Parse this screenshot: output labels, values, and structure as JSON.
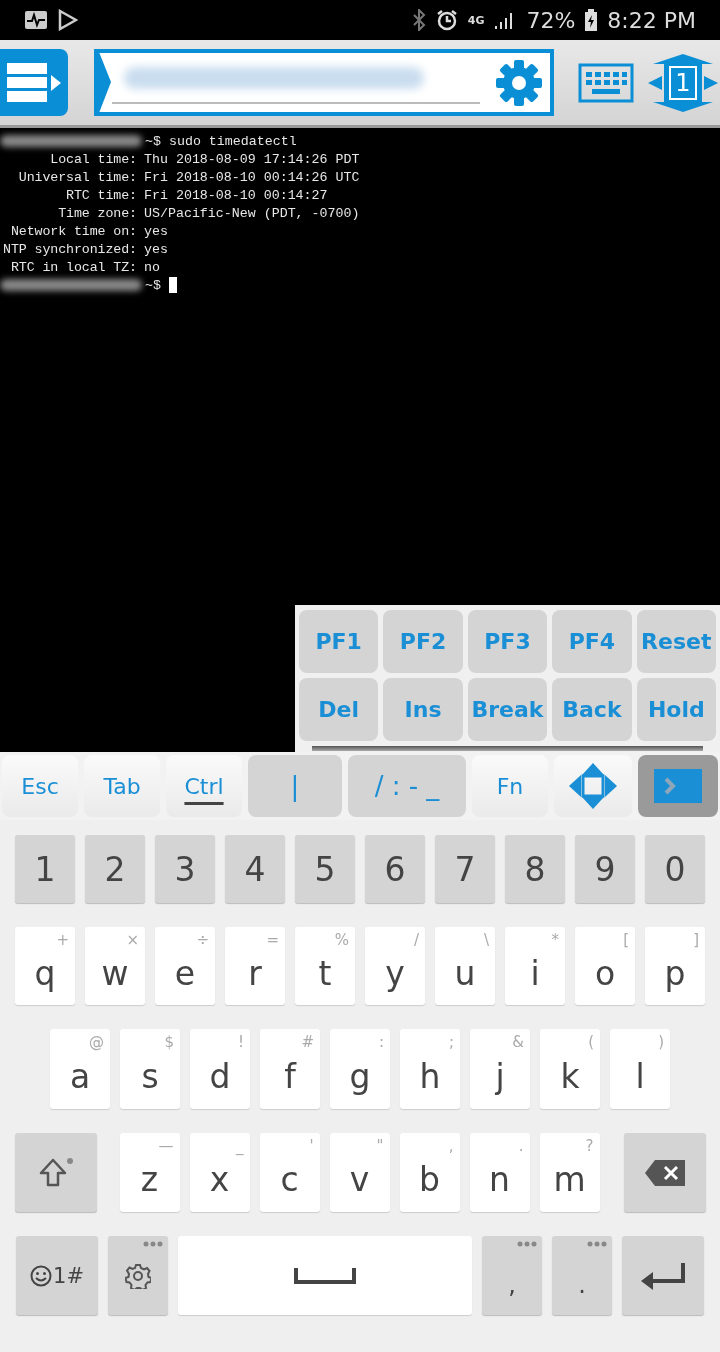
{
  "status_bar": {
    "network": "4G",
    "battery": "72%",
    "time": "8:22 PM"
  },
  "toolbar": {
    "session": "1"
  },
  "terminal": {
    "lines": [
      {
        "kind": "command",
        "prompt": "~$",
        "text": "sudo timedatectl"
      },
      {
        "kind": "field",
        "label": "Local time:",
        "value": "Thu 2018-08-09 17:14:26 PDT"
      },
      {
        "kind": "field",
        "label": "Universal time:",
        "value": "Fri 2018-08-10 00:14:26 UTC"
      },
      {
        "kind": "field",
        "label": "RTC time:",
        "value": "Fri 2018-08-10 00:14:27"
      },
      {
        "kind": "field",
        "label": "Time zone:",
        "value": "US/Pacific-New (PDT, -0700)"
      },
      {
        "kind": "field",
        "label": "Network time on:",
        "value": "yes"
      },
      {
        "kind": "field",
        "label": "NTP synchronized:",
        "value": "yes"
      },
      {
        "kind": "field",
        "label": "RTC in local TZ:",
        "value": "no"
      },
      {
        "kind": "prompt",
        "prompt": "~$"
      }
    ]
  },
  "function_keys": [
    [
      "PF1",
      "PF2",
      "PF3",
      "PF4",
      "Reset"
    ],
    [
      "Del",
      "Ins",
      "Break",
      "Back",
      "Hold"
    ]
  ],
  "extra_keys": [
    {
      "kind": "key",
      "label": "Esc",
      "selected": false
    },
    {
      "kind": "key",
      "label": "Tab",
      "selected": false
    },
    {
      "kind": "key",
      "label": "Ctrl",
      "selected": true
    },
    {
      "kind": "symbol",
      "label": "|",
      "selected": false
    },
    {
      "kind": "symbol",
      "label": "/ : - _",
      "selected": false
    },
    {
      "kind": "key",
      "label": "Fn",
      "selected": false
    },
    {
      "kind": "arrows",
      "selected": false
    },
    {
      "kind": "terminal",
      "selected": false
    }
  ],
  "keyboard": {
    "numbers": [
      "1",
      "2",
      "3",
      "4",
      "5",
      "6",
      "7",
      "8",
      "9",
      "0"
    ],
    "row_1": [
      {
        "key": "q",
        "hint": "+"
      },
      {
        "key": "w",
        "hint": "×"
      },
      {
        "key": "e",
        "hint": "÷"
      },
      {
        "key": "r",
        "hint": "="
      },
      {
        "key": "t",
        "hint": "%"
      },
      {
        "key": "y",
        "hint": "/"
      },
      {
        "key": "u",
        "hint": "\\"
      },
      {
        "key": "i",
        "hint": "*"
      },
      {
        "key": "o",
        "hint": "["
      },
      {
        "key": "p",
        "hint": "]"
      }
    ],
    "row_2": [
      {
        "key": "a",
        "hint": "@"
      },
      {
        "key": "s",
        "hint": "$"
      },
      {
        "key": "d",
        "hint": "!"
      },
      {
        "key": "f",
        "hint": "#"
      },
      {
        "key": "g",
        "hint": ":"
      },
      {
        "key": "h",
        "hint": ";"
      },
      {
        "key": "j",
        "hint": "&"
      },
      {
        "key": "k",
        "hint": "("
      },
      {
        "key": "l",
        "hint": ")"
      }
    ],
    "row_3": [
      {
        "key": "z",
        "hint": "—"
      },
      {
        "key": "x",
        "hint": "_"
      },
      {
        "key": "c",
        "hint": "'"
      },
      {
        "key": "v",
        "hint": "\""
      },
      {
        "key": "b",
        "hint": ","
      },
      {
        "key": "n",
        "hint": "."
      },
      {
        "key": "m",
        "hint": "?"
      }
    ],
    "symbols_key": "1#",
    "comma": ",",
    "period": "."
  }
}
